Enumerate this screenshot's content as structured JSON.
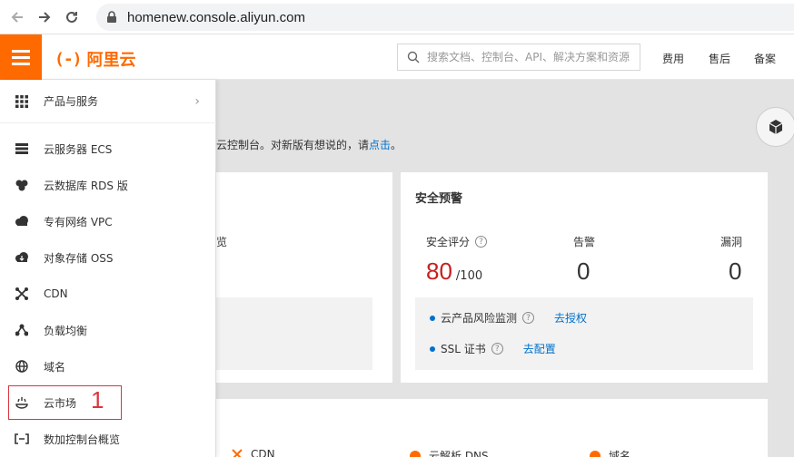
{
  "browser": {
    "url": "homenew.console.aliyun.com"
  },
  "header": {
    "logo_mark": "(-)",
    "logo_text": "阿里云",
    "search_placeholder": "搜索文档、控制台、API、解决方案和资源",
    "links": [
      "费用",
      "售后",
      "备案"
    ]
  },
  "sidebar": {
    "products_label": "产品与服务",
    "items": [
      {
        "label": "云服务器 ECS",
        "icon": "server-icon"
      },
      {
        "label": "云数据库 RDS 版",
        "icon": "database-icon"
      },
      {
        "label": "专有网络 VPC",
        "icon": "cloud-network-icon"
      },
      {
        "label": "对象存储 OSS",
        "icon": "cloud-storage-icon"
      },
      {
        "label": "CDN",
        "icon": "cdn-icon"
      },
      {
        "label": "负载均衡",
        "icon": "load-balancer-icon"
      },
      {
        "label": "域名",
        "icon": "globe-icon"
      },
      {
        "label": "云市场",
        "icon": "market-icon"
      },
      {
        "label": "数加控制台概览",
        "icon": "console-icon"
      }
    ],
    "annotation_number": "1"
  },
  "main": {
    "notice_text": "云控制台。对新版有想说的，请",
    "notice_link": "点击",
    "notice_end": "。",
    "left_card_fragment": "览",
    "security": {
      "title": "安全预警",
      "score_label": "安全评分",
      "score_value": "80",
      "score_max": "/100",
      "alert_label": "告警",
      "alert_value": "0",
      "vuln_label": "漏洞",
      "vuln_value": "0",
      "rows": [
        {
          "label": "云产品风险监测",
          "link": "去授权"
        },
        {
          "label": "SSL 证书",
          "link": "去配置"
        }
      ]
    },
    "bottom_items": [
      "CDN",
      "云解析 DNS",
      "域名"
    ]
  },
  "colors": {
    "brand": "#ff6a00",
    "link": "#0070cc",
    "score": "#c7201f",
    "annotation": "#d9363e"
  }
}
